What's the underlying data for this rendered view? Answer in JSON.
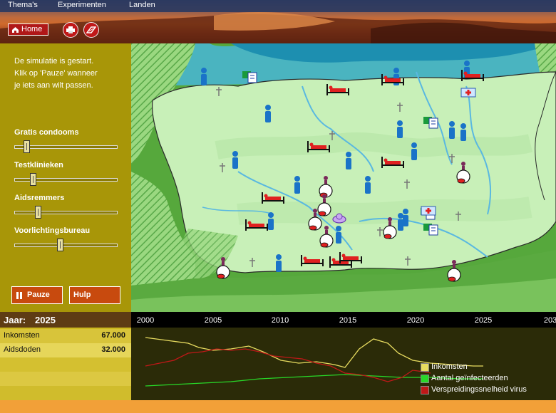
{
  "menu": {
    "items": [
      {
        "label": "Thema's"
      },
      {
        "label": "Experimenten"
      },
      {
        "label": "Landen"
      }
    ]
  },
  "toolbar": {
    "home_label": "Home",
    "print_icon": "print-icon",
    "info_icon": "info-icon"
  },
  "sidebar": {
    "status": "De simulatie is gestart.\nKlik op 'Pauze' wanneer\nje iets aan wilt passen.",
    "sliders": [
      {
        "label": "Gratis condooms",
        "value": 0.12
      },
      {
        "label": "Testklinieken",
        "value": 0.19
      },
      {
        "label": "Aidsremmers",
        "value": 0.24
      },
      {
        "label": "Voorlichtingsbureau",
        "value": 0.46
      }
    ],
    "pause_label": "Pauze",
    "help_label": "Hulp"
  },
  "year": {
    "label": "Jaar:",
    "value": "2025"
  },
  "timeline": {
    "ticks": [
      "2000",
      "2005",
      "2010",
      "2015",
      "2020",
      "2025",
      "203"
    ]
  },
  "stats": [
    {
      "label": "Inkomsten",
      "value": "67.000"
    },
    {
      "label": "Aidsdoden",
      "value": "32.000"
    }
  ],
  "legend": [
    {
      "label": "Inkomsten",
      "color": "#e8dc60"
    },
    {
      "label": "Aantal geïnfecteerden",
      "color": "#28d828"
    },
    {
      "label": "Verspreidingssnelheid virus",
      "color": "#c01818"
    }
  ],
  "colors": {
    "sidebar": "#a89608",
    "stats_bg": "#ccb81e",
    "graph_bg": "#2b2b08",
    "map_land": "#c8f0b8",
    "water": "#1e9ab8",
    "accent": "#c84a0e"
  },
  "map_icons": {
    "people": [
      [
        286,
        108
      ],
      [
        376,
        160
      ],
      [
        330,
        225
      ],
      [
        417,
        260
      ],
      [
        489,
        226
      ],
      [
        516,
        260
      ],
      [
        561,
        182
      ],
      [
        581,
        213
      ],
      [
        634,
        183
      ],
      [
        650,
        186
      ],
      [
        380,
        311
      ],
      [
        391,
        370
      ],
      [
        475,
        330
      ],
      [
        562,
        312
      ],
      [
        569,
        306
      ],
      [
        556,
        108
      ],
      [
        655,
        98
      ]
    ],
    "beds": [
      [
        551,
        112
      ],
      [
        474,
        126
      ],
      [
        663,
        106
      ],
      [
        447,
        206
      ],
      [
        551,
        228
      ],
      [
        383,
        278
      ],
      [
        360,
        316
      ],
      [
        438,
        366
      ],
      [
        478,
        368
      ],
      [
        492,
        362
      ]
    ],
    "patients": [
      [
        650,
        246
      ],
      [
        457,
        266
      ],
      [
        455,
        292
      ],
      [
        442,
        312
      ],
      [
        458,
        336
      ],
      [
        547,
        324
      ],
      [
        313,
        380
      ],
      [
        637,
        384
      ]
    ],
    "graves": [
      [
        307,
        128
      ],
      [
        466,
        190
      ],
      [
        312,
        235
      ],
      [
        571,
        258
      ],
      [
        634,
        222
      ],
      [
        643,
        303
      ],
      [
        354,
        368
      ],
      [
        533,
        325
      ],
      [
        572,
        366
      ],
      [
        561,
        150
      ]
    ],
    "clinics": [
      [
        350,
        108
      ],
      [
        604,
        172
      ],
      [
        600,
        300
      ],
      [
        604,
        322
      ]
    ],
    "hospitals": [
      [
        657,
        130
      ],
      [
        601,
        296
      ]
    ],
    "condoms": [
      [
        476,
        308
      ]
    ]
  }
}
